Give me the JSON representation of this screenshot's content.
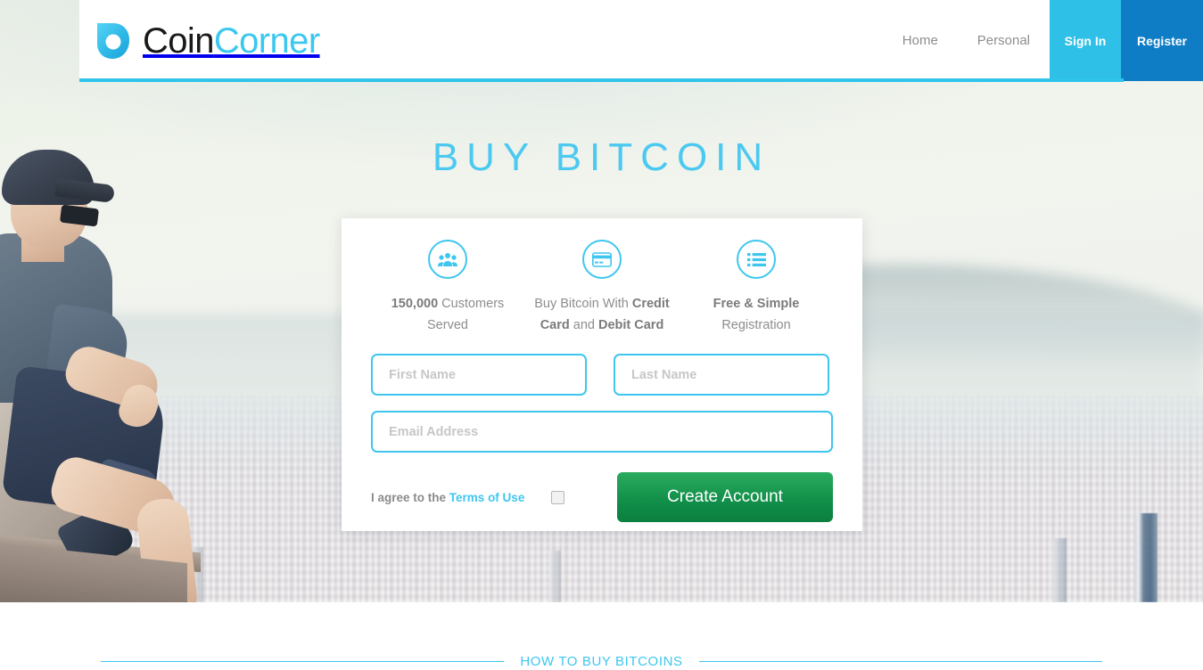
{
  "header": {
    "logo": {
      "icon": "coincorner-droplet-logo",
      "text_primary": "Coin",
      "text_accent": "Corner"
    },
    "nav_links": [
      {
        "label": "Home"
      },
      {
        "label": "Personal"
      }
    ],
    "sign_in_label": "Sign In",
    "register_label": "Register"
  },
  "hero": {
    "title": "BUY BITCOIN"
  },
  "card": {
    "features": [
      {
        "icon": "users-group-icon",
        "parts": [
          {
            "text": "150,000",
            "bold": true
          },
          {
            "text": " Customers Served",
            "bold": false
          }
        ]
      },
      {
        "icon": "credit-card-icon",
        "parts": [
          {
            "text": "Buy Bitcoin With ",
            "bold": false
          },
          {
            "text": "Credit Card",
            "bold": true
          },
          {
            "text": " and ",
            "bold": false
          },
          {
            "text": "Debit Card",
            "bold": true
          }
        ]
      },
      {
        "icon": "list-icon",
        "parts": [
          {
            "text": "Free & Simple",
            "bold": true
          },
          {
            "text": " Registration",
            "bold": false
          }
        ]
      }
    ],
    "form": {
      "first_name": {
        "value": "",
        "placeholder": "First Name"
      },
      "last_name": {
        "value": "",
        "placeholder": "Last Name"
      },
      "email": {
        "value": "",
        "placeholder": "Email Address"
      },
      "agree_prefix": "I agree to the",
      "terms_link_label": "Terms of Use",
      "agree_checked": false,
      "submit_label": "Create Account"
    }
  },
  "bottom": {
    "section_label": "HOW TO BUY BITCOINS"
  },
  "colors": {
    "cyan": "#3ec6ef",
    "sign_in_blue": "#2fc0e8",
    "register_blue": "#0f7dc6",
    "green": "#12904a",
    "gray_text": "#8d8d8d"
  }
}
